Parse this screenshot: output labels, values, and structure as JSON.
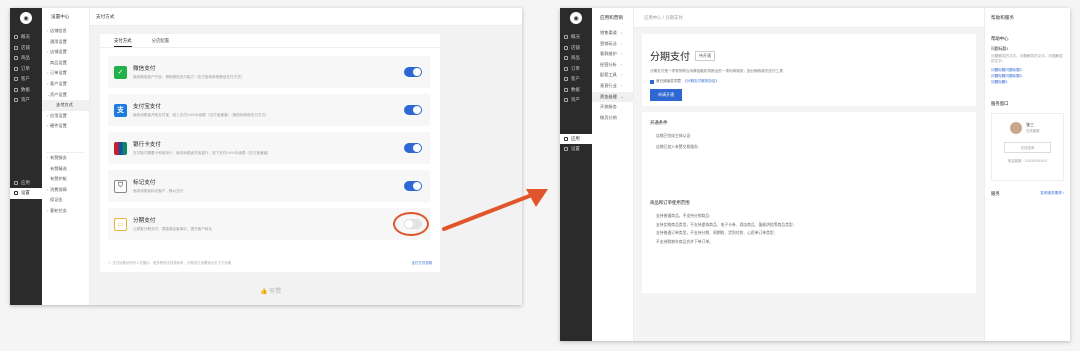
{
  "left": {
    "rail": {
      "items": [
        {
          "label": "概况"
        },
        {
          "label": "店铺"
        },
        {
          "label": "商品"
        },
        {
          "label": "订单"
        },
        {
          "label": "客户"
        },
        {
          "label": "数据"
        },
        {
          "label": "资产"
        }
      ],
      "bottom": [
        {
          "label": "应用"
        },
        {
          "label": "设置"
        }
      ]
    },
    "sub": {
      "title": "设置中心",
      "items": [
        {
          "label": "店铺信息",
          "caret": "›"
        },
        {
          "label": "通用设置",
          "caret": ""
        },
        {
          "label": "店铺设置",
          "caret": "›"
        },
        {
          "label": "商品设置",
          "caret": ""
        },
        {
          "label": "订单设置",
          "caret": "›"
        },
        {
          "label": "客户设置",
          "caret": "›"
        },
        {
          "label": "资产设置",
          "caret": "⌄"
        },
        {
          "label": "支付方式",
          "caret": ""
        },
        {
          "label": "应用设置",
          "caret": "›"
        },
        {
          "label": "硬件设置",
          "caret": "›"
        }
      ],
      "lower": [
        {
          "label": "有赞服务"
        },
        {
          "label": "有赞精选"
        },
        {
          "label": "有赞护航"
        },
        {
          "label": "消费保障"
        },
        {
          "label": "保证金"
        },
        {
          "label": "客蛇任务"
        }
      ]
    },
    "top_title": "支付方式",
    "tabs": [
      "支付方式",
      "分店配置"
    ],
    "methods": [
      {
        "title": "微信支付",
        "desc": "面向微信客户开放，借助微信支付能力（支付宝和其他微信支付方式）",
        "on": true,
        "color": "#22b04b",
        "icon": "wechat-pay-icon"
      },
      {
        "title": "支付宝支付",
        "desc": "面向消费者开放支付宝，线上支付0.6%手续费（支付宝通道）（微信和其他支付方式）",
        "on": true,
        "color": "#1e7be0",
        "icon": "alipay-icon"
      },
      {
        "title": "银行卡支付",
        "desc": "支付接口需要卡和信用卡，面向消费者开放银行，线下支付0.6%手续费（支付宝通道）",
        "on": true,
        "color": "#c8202a",
        "icon": "unionpay-icon"
      },
      {
        "title": "标记支付",
        "desc": "面向消费者标记客户，静以交付",
        "on": true,
        "color": "#888888",
        "icon": "tag-pay-icon"
      },
      {
        "title": "分期支付",
        "desc": "让顾客分期支付，提高商品客单价，提升客户转化",
        "on": false,
        "color": "#e8b341",
        "icon": "installment-card-icon"
      }
    ],
    "footnote": "ⓘ 支付设置对所有人员展示，更多帮助文档请参考，分期支付设置请点击下方设置",
    "footlink": "支付方式说明",
    "brand": "有赞"
  },
  "right": {
    "rail": {
      "items": [
        {
          "label": "概况"
        },
        {
          "label": "店铺"
        },
        {
          "label": "商品"
        },
        {
          "label": "订单"
        },
        {
          "label": "客户"
        },
        {
          "label": "数据"
        },
        {
          "label": "资产"
        }
      ],
      "bottom": [
        {
          "label": "应用"
        },
        {
          "label": "设置"
        }
      ]
    },
    "sub": {
      "title": "应用和营销",
      "items": [
        {
          "label": "销售渠道",
          "caret": "›"
        },
        {
          "label": "营销玩法",
          "caret": "›"
        },
        {
          "label": "客群维护",
          "caret": "›"
        },
        {
          "label": "经营分析",
          "caret": "›"
        },
        {
          "label": "配套工具",
          "caret": "›"
        },
        {
          "label": "垂直行业",
          "caret": "›"
        },
        {
          "label": "资金处理",
          "caret": "⌄"
        },
        {
          "label": "开放服务",
          "caret": ""
        },
        {
          "label": "微页分销",
          "caret": ""
        }
      ]
    },
    "breadcrumb": "应用中心  /  分期支付",
    "product": {
      "title": "分期支付",
      "badge": "待开通",
      "desc": "分期支付是一项有赞联合持牌金融机构推出的一项利润服务，因分期收款的支付工具",
      "agree_text": "我已阅读并同意",
      "agree_link": "《分期支付服务协议》",
      "button": "申请开通"
    },
    "conditions": {
      "title": "开通条件",
      "items": [
        "店铺已完成主体认证;",
        "店铺已加入有赞交易服务;"
      ]
    },
    "scope": {
      "title": "商品和订单使用范围",
      "items": [
        "支持普通商品，不支持分销商品;",
        "支持实物商品类型，不支持虚拟商品、电子卡券、酒店商品、蛋糕烘焙等商品类型;",
        "支持普通订单类型，不支持分期、周期购、货到付款、心愿单订单类型;",
        "不支持购物车商品合并下单订单。"
      ]
    },
    "help": {
      "title": "帮助和服务",
      "center_title": "帮助中心",
      "q": "问题标题1",
      "a": "问题解答的文字。问题解答的文字。问题解答的文字。",
      "links": [
        "问题标题问题标题2",
        "问题标题问题标题3",
        "问题标题4"
      ],
      "service_title": "服务窗口",
      "manager_name": "张三",
      "manager_role": "在线客服",
      "contact_btn": "在线咨询",
      "phone": "电话客服：1XXXXXXXXX",
      "svc_title": "服务",
      "svc_link": "发布服务需求 ›"
    }
  }
}
